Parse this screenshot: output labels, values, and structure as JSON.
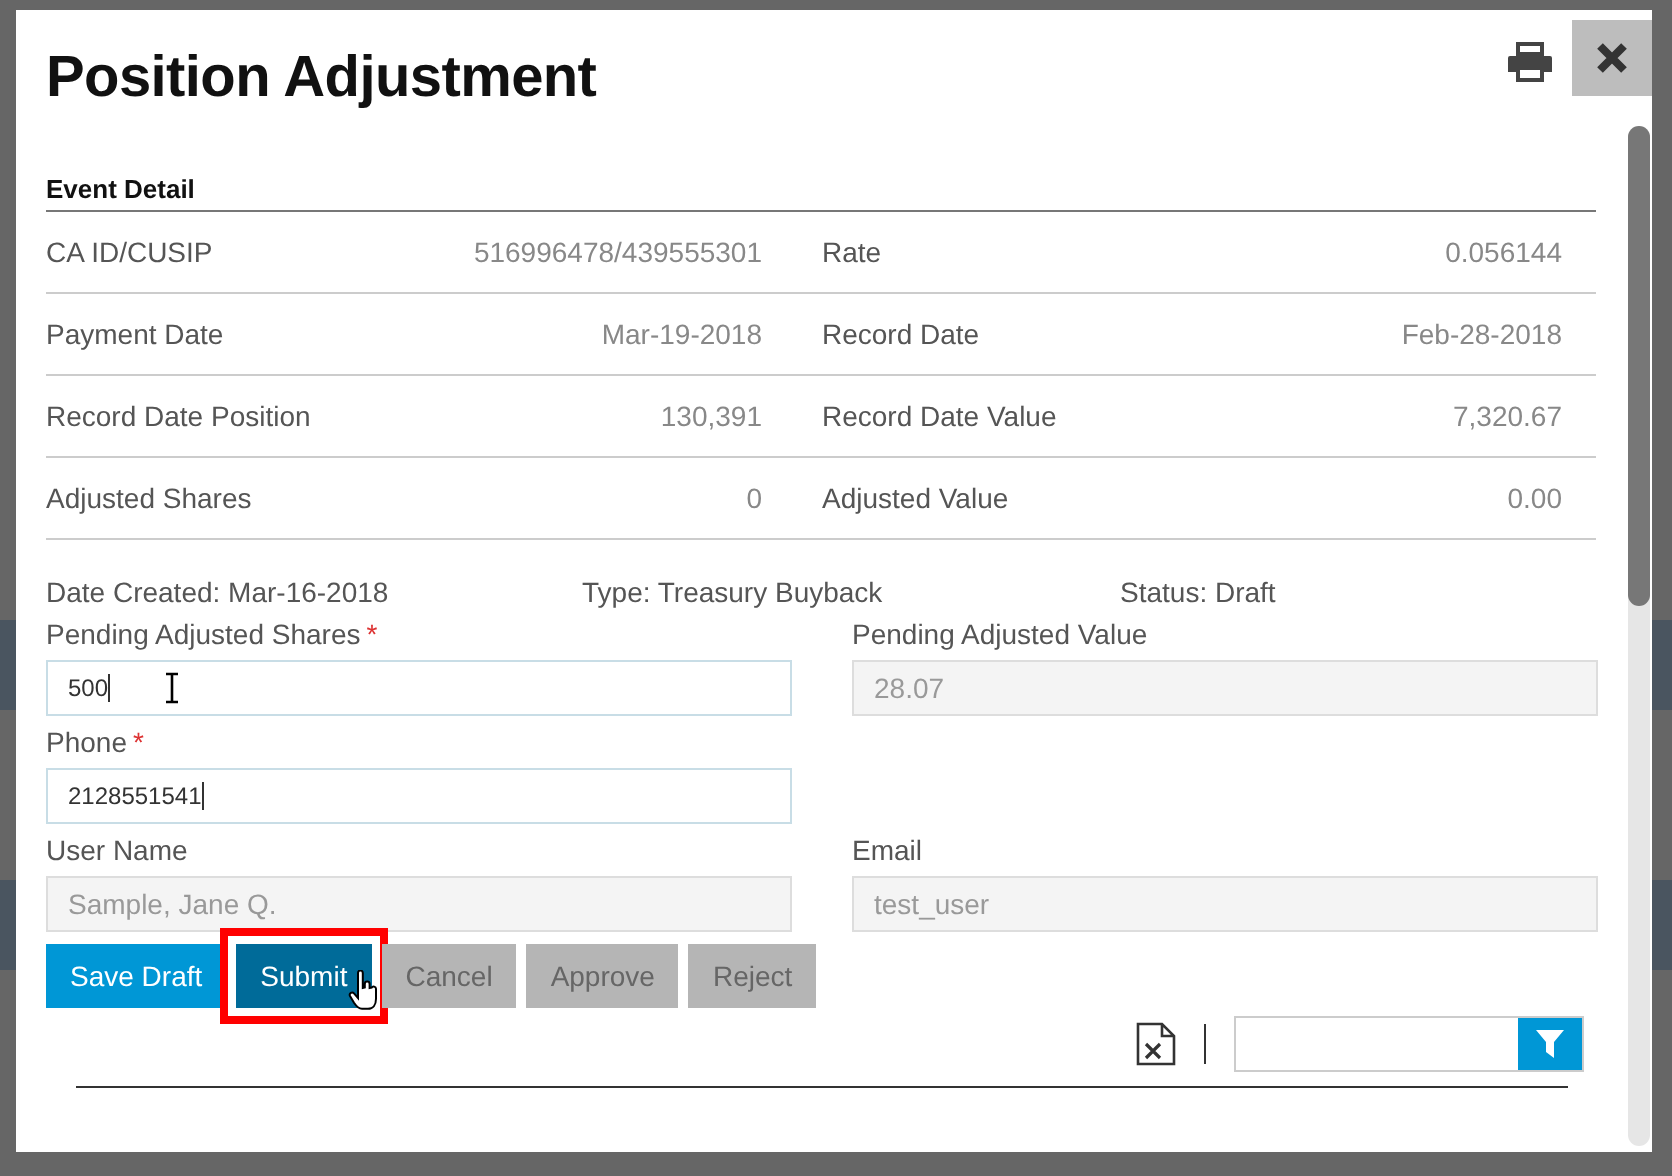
{
  "dialog": {
    "title": "Position Adjustment",
    "section_title": "Event Detail"
  },
  "details": [
    {
      "label": "CA ID/CUSIP",
      "value": "516996478/439555301",
      "label_2": "Rate",
      "value_2": "0.056144"
    },
    {
      "label": "Payment Date",
      "value": "Mar-19-2018",
      "label_2": "Record Date",
      "value_2": "Feb-28-2018"
    },
    {
      "label": "Record Date Position",
      "value": "130,391",
      "label_2": "Record Date Value",
      "value_2": "7,320.67"
    },
    {
      "label": "Adjusted Shares",
      "value": "0",
      "label_2": "Adjusted Value",
      "value_2": "0.00"
    }
  ],
  "meta": [
    "Date Created: Mar-16-2018",
    "Type: Treasury Buyback",
    "Status: Draft"
  ],
  "field_rows": [
    [
      {
        "label": "Pending Adjusted Shares",
        "required_mark": "*",
        "value": "500",
        "disabled": false,
        "cursor": true
      },
      {
        "label": "Pending Adjusted Value",
        "value": "28.07",
        "disabled": true,
        "cursor": false
      }
    ],
    [
      {
        "label": "Phone",
        "required_mark": "*",
        "value": "2128551541",
        "disabled": false,
        "cursor": false
      }
    ],
    [
      {
        "label": "User Name",
        "value": "Sample, Jane Q.",
        "disabled": true,
        "cursor": false
      },
      {
        "label": "Email",
        "value": "test_user",
        "disabled": true,
        "cursor": false
      }
    ]
  ],
  "buttons": [
    {
      "label": "Save Draft",
      "kind": "primary",
      "disabled": false,
      "highlighted": false
    },
    {
      "label": "Submit",
      "kind": "dark",
      "disabled": false,
      "highlighted": true
    },
    {
      "label": "Cancel",
      "kind": "plain",
      "disabled": true,
      "highlighted": false
    },
    {
      "label": "Approve",
      "kind": "plain",
      "disabled": true,
      "highlighted": false
    },
    {
      "label": "Reject",
      "kind": "plain",
      "disabled": true,
      "highlighted": false
    }
  ]
}
